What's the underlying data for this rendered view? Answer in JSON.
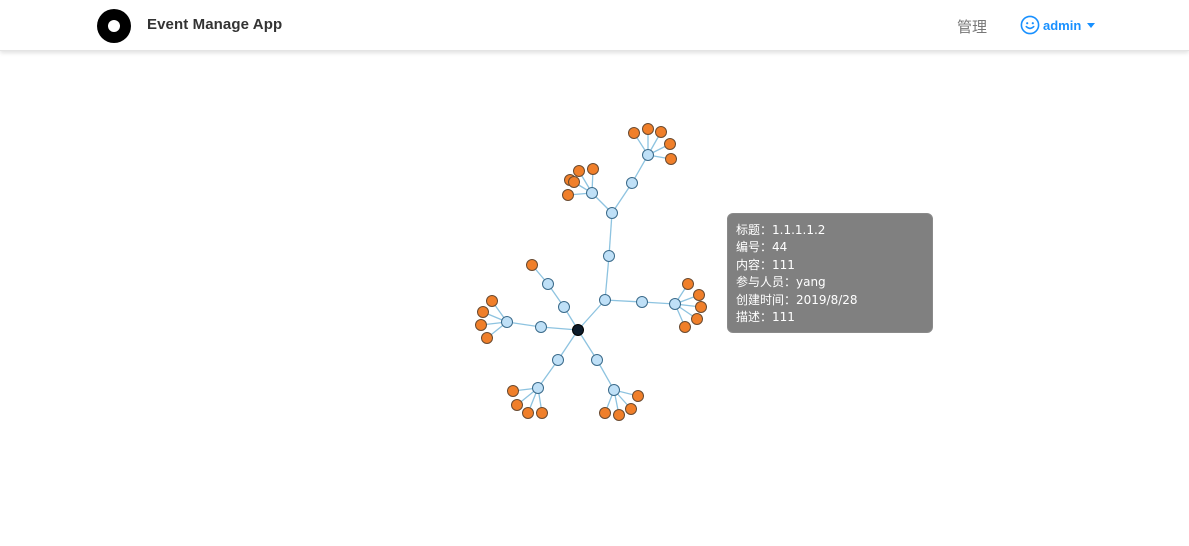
{
  "header": {
    "app_title": "Event Manage App",
    "nav_manage": "管理",
    "user_name": "admin"
  },
  "tooltip": {
    "lines": [
      "标题：1.1.1.1.2",
      "编号：44",
      "内容：111",
      "参与人员：yang",
      "创建时间：2019/8/28",
      "描述：111"
    ]
  },
  "colors": {
    "root": "#0d1b2a",
    "branch_fill": "#bfe0f7",
    "branch_stroke": "#3a6a8a",
    "leaf_fill": "#f07f2a",
    "leaf_stroke": "#6a4a30",
    "link": "#8dc3e0",
    "accent": "#1890ff"
  },
  "graph": {
    "nodes": [
      {
        "id": "root",
        "type": "root"
      },
      {
        "id": "a",
        "type": "branch"
      },
      {
        "id": "a1",
        "type": "branch"
      },
      {
        "id": "a2",
        "type": "branch"
      },
      {
        "id": "a3",
        "type": "branch"
      },
      {
        "id": "a4",
        "type": "branch"
      },
      {
        "id": "a5",
        "type": "branch"
      },
      {
        "id": "a4l1",
        "type": "leaf"
      },
      {
        "id": "a4l2",
        "type": "leaf"
      },
      {
        "id": "a4l3",
        "type": "leaf"
      },
      {
        "id": "a4l4",
        "type": "leaf"
      },
      {
        "id": "a4l5",
        "type": "leaf"
      },
      {
        "id": "a5l1",
        "type": "leaf"
      },
      {
        "id": "a5l2",
        "type": "leaf"
      },
      {
        "id": "a5l3",
        "type": "leaf"
      },
      {
        "id": "a5l4",
        "type": "leaf"
      },
      {
        "id": "a5l5",
        "type": "leaf"
      },
      {
        "id": "b",
        "type": "branch"
      },
      {
        "id": "b1",
        "type": "branch"
      },
      {
        "id": "b1l1",
        "type": "leaf"
      },
      {
        "id": "b1l2",
        "type": "leaf"
      },
      {
        "id": "b1l3",
        "type": "leaf"
      },
      {
        "id": "b1l4",
        "type": "leaf"
      },
      {
        "id": "b1l5",
        "type": "leaf"
      },
      {
        "id": "c",
        "type": "branch"
      },
      {
        "id": "c1",
        "type": "branch"
      },
      {
        "id": "c2",
        "type": "leaf"
      },
      {
        "id": "d",
        "type": "branch"
      },
      {
        "id": "d1",
        "type": "branch"
      },
      {
        "id": "d1l1",
        "type": "leaf"
      },
      {
        "id": "d1l2",
        "type": "leaf"
      },
      {
        "id": "d1l3",
        "type": "leaf"
      },
      {
        "id": "d1l4",
        "type": "leaf"
      },
      {
        "id": "e",
        "type": "branch"
      },
      {
        "id": "e1",
        "type": "branch"
      },
      {
        "id": "e1l1",
        "type": "leaf"
      },
      {
        "id": "e1l2",
        "type": "leaf"
      },
      {
        "id": "e1l3",
        "type": "leaf"
      },
      {
        "id": "e1l4",
        "type": "leaf"
      },
      {
        "id": "f",
        "type": "branch"
      },
      {
        "id": "f1",
        "type": "branch"
      },
      {
        "id": "f1l1",
        "type": "leaf"
      },
      {
        "id": "f1l2",
        "type": "leaf"
      },
      {
        "id": "f1l3",
        "type": "leaf"
      },
      {
        "id": "f1l4",
        "type": "leaf"
      }
    ],
    "links": [
      [
        "root",
        "a"
      ],
      [
        "a",
        "a1"
      ],
      [
        "a1",
        "a2"
      ],
      [
        "a2",
        "a3"
      ],
      [
        "a3",
        "a4"
      ],
      [
        "a2",
        "a5"
      ],
      [
        "a4",
        "a4l1"
      ],
      [
        "a4",
        "a4l2"
      ],
      [
        "a4",
        "a4l3"
      ],
      [
        "a4",
        "a4l4"
      ],
      [
        "a4",
        "a4l5"
      ],
      [
        "a5",
        "a5l1"
      ],
      [
        "a5",
        "a5l2"
      ],
      [
        "a5",
        "a5l3"
      ],
      [
        "a5",
        "a5l4"
      ],
      [
        "a5",
        "a5l5"
      ],
      [
        "a",
        "b"
      ],
      [
        "b",
        "b1"
      ],
      [
        "b1",
        "b1l1"
      ],
      [
        "b1",
        "b1l2"
      ],
      [
        "b1",
        "b1l3"
      ],
      [
        "b1",
        "b1l4"
      ],
      [
        "b1",
        "b1l5"
      ],
      [
        "root",
        "c"
      ],
      [
        "c",
        "c1"
      ],
      [
        "c1",
        "c2"
      ],
      [
        "root",
        "d"
      ],
      [
        "d",
        "d1"
      ],
      [
        "d1",
        "d1l1"
      ],
      [
        "d1",
        "d1l2"
      ],
      [
        "d1",
        "d1l3"
      ],
      [
        "d1",
        "d1l4"
      ],
      [
        "root",
        "e"
      ],
      [
        "e",
        "e1"
      ],
      [
        "e1",
        "e1l1"
      ],
      [
        "e1",
        "e1l2"
      ],
      [
        "e1",
        "e1l3"
      ],
      [
        "e1",
        "e1l4"
      ],
      [
        "root",
        "f"
      ],
      [
        "f",
        "f1"
      ],
      [
        "f1",
        "f1l1"
      ],
      [
        "f1",
        "f1l2"
      ],
      [
        "f1",
        "f1l3"
      ],
      [
        "f1",
        "f1l4"
      ]
    ]
  }
}
